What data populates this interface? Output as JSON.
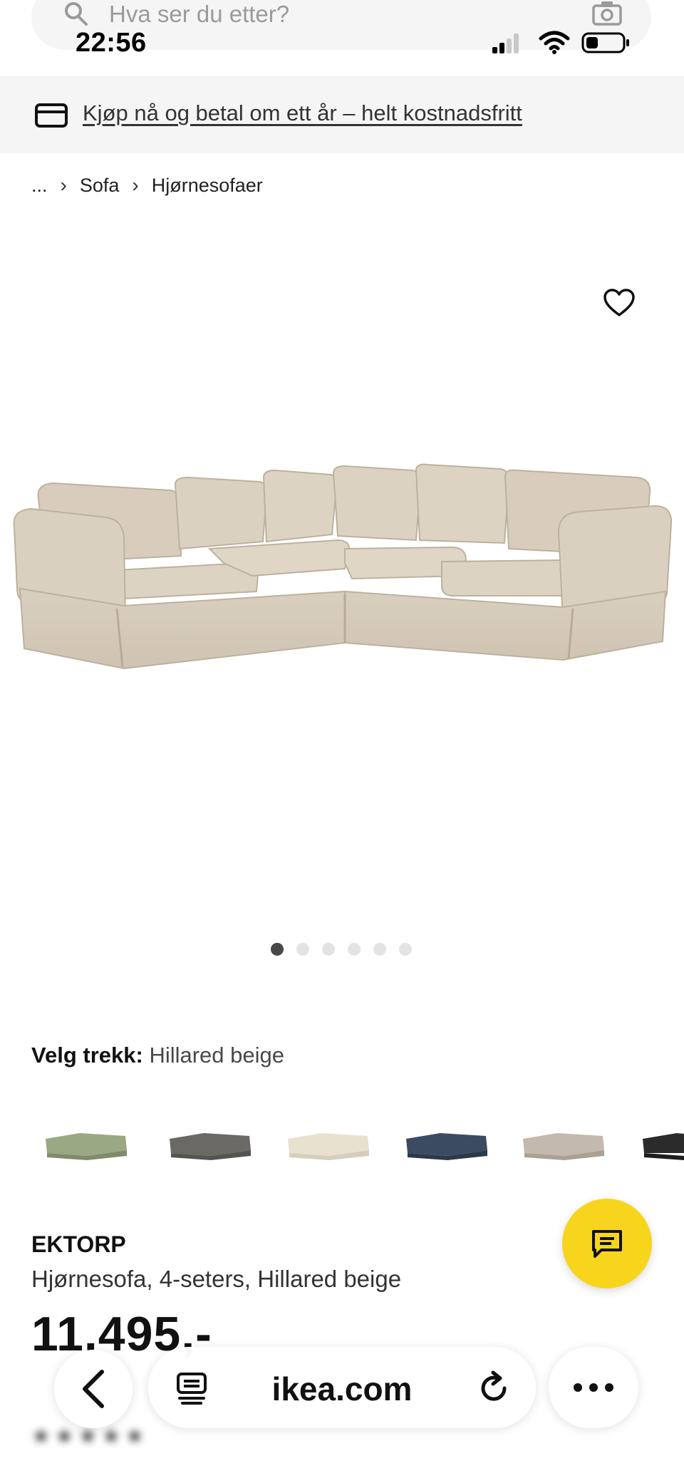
{
  "status_bar": {
    "time": "22:56"
  },
  "search": {
    "placeholder": "Hva ser du etter?"
  },
  "promo": {
    "text": "Kjøp nå og betal om ett år – helt kostnadsfritt"
  },
  "breadcrumb": {
    "items": [
      "...",
      "Sofa",
      "Hjørnesofaer"
    ]
  },
  "gallery": {
    "image_count": 6,
    "active_index": 0
  },
  "cover": {
    "label": "Velg trekk:",
    "value": "Hillared beige",
    "swatches": [
      {
        "name": "green",
        "color": "#9aa883"
      },
      {
        "name": "dark-grey",
        "color": "#6a6966"
      },
      {
        "name": "cream",
        "color": "#e8e1cf"
      },
      {
        "name": "dark-blue",
        "color": "#3b4b62"
      },
      {
        "name": "greige",
        "color": "#c3b9ae"
      },
      {
        "name": "black",
        "color": "#2b2b2b"
      }
    ]
  },
  "product": {
    "name": "EKTORP",
    "description": "Hjørnesofa, 4-seters, Hillared beige",
    "price": "11.495,-"
  },
  "browser": {
    "url": "ikea.com"
  },
  "colors": {
    "chat_fab": "#f7d51d",
    "sofa": "#dcd2c2"
  }
}
